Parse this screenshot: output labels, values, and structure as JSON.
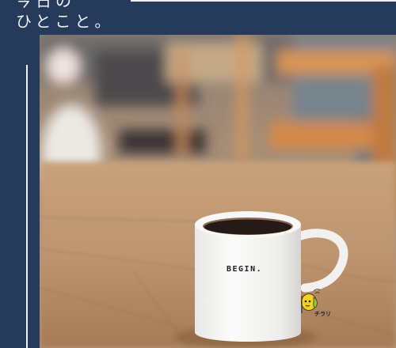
{
  "header": {
    "title_line1": "今日の",
    "title_line2": "ひとこと。"
  },
  "photo": {
    "mug_text": "BEGIN.",
    "mascot_label": "チラリ"
  },
  "colors": {
    "background": "#263a5b",
    "rule": "#eef1f6"
  },
  "icons": {
    "mascot": "peeking-character-icon"
  }
}
